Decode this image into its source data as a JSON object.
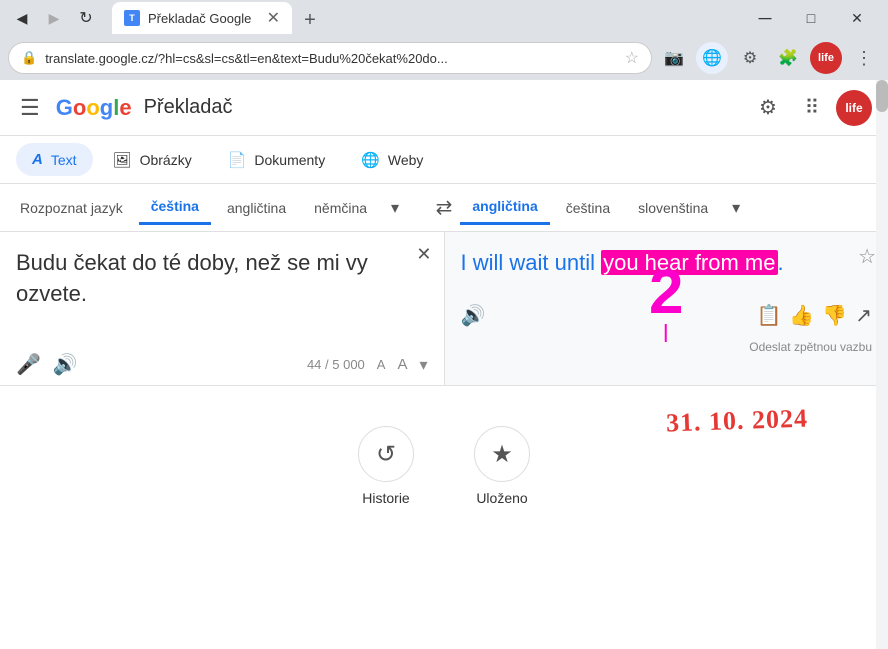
{
  "browser": {
    "tab_title": "Překladač Google",
    "url": "translate.google.cz/?hl=cs&sl=cs&tl=en&text=Budu%20čekat%20do...",
    "back_btn": "◀",
    "forward_btn": "▶",
    "refresh_btn": "↻",
    "win_minimize": "─",
    "win_restore": "□",
    "win_close": "✕",
    "new_tab": "+"
  },
  "header": {
    "hamburger": "☰",
    "logo_text": "Překladač",
    "settings_icon": "⚙",
    "apps_icon": "⠿"
  },
  "nav_tabs": [
    {
      "label": "Text",
      "icon": "Aa",
      "active": true
    },
    {
      "label": "Obrázky",
      "icon": "🖼",
      "active": false
    },
    {
      "label": "Dokumenty",
      "icon": "📄",
      "active": false
    },
    {
      "label": "Weby",
      "icon": "🌐",
      "active": false
    }
  ],
  "source_langs": [
    {
      "label": "Rozpoznat jazyk",
      "active": false
    },
    {
      "label": "čeština",
      "active": true
    },
    {
      "label": "angličtina",
      "active": false
    },
    {
      "label": "němčina",
      "active": false
    }
  ],
  "target_langs": [
    {
      "label": "angličtina",
      "active": true
    },
    {
      "label": "čeština",
      "active": false
    },
    {
      "label": "slovenština",
      "active": false
    }
  ],
  "input": {
    "text": "Budu čekat do té doby, než se mi vy ozvete.",
    "char_count": "44 / 5 000"
  },
  "output": {
    "text_before_highlight": "I will wait until ",
    "highlight": "you hear from me",
    "text_after_highlight": ".",
    "annotation_number": "2"
  },
  "footer": {
    "feedback_label": "Odeslat zpětnou vazbu"
  },
  "bottom": {
    "date_annotation": "31. 10. 2024",
    "history_label": "Historie",
    "saved_label": "Uloženo"
  }
}
